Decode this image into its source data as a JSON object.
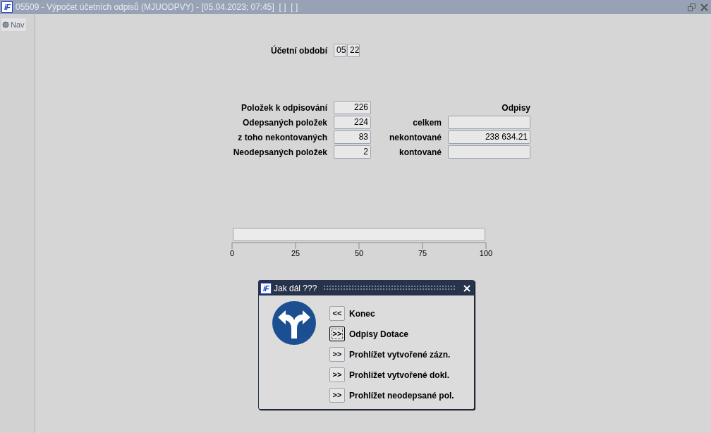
{
  "window": {
    "logo": "iF",
    "title": "05509 - Výpočet účetních odpisů (MJUODPVY) - [05.04.2023; 07:45]  [ ]  [ ]"
  },
  "sidebar": {
    "tabs": [
      {
        "label": "Nav",
        "selected": true
      }
    ]
  },
  "period": {
    "label": "Účetní období",
    "fields": [
      "05",
      "22"
    ]
  },
  "counts": [
    {
      "label": "Položek k odpisování",
      "value": "226"
    },
    {
      "label": "Odepsaných položek",
      "value": "224"
    },
    {
      "label": "z toho nekontovaných",
      "value": "83"
    },
    {
      "label": "Neodepsaných položek",
      "value": "2"
    }
  ],
  "odpisy": {
    "heading": "Odpisy",
    "rows": [
      {
        "label": "celkem",
        "value": ""
      },
      {
        "label": "nekontované",
        "value": "238 634.21"
      },
      {
        "label": "kontované",
        "value": ""
      }
    ]
  },
  "progress": {
    "level": 0,
    "scale": [
      "0",
      "25",
      "50",
      "75",
      "100"
    ]
  },
  "dialog": {
    "logo": "iF",
    "title": "Jak dál ???",
    "options": [
      {
        "button": "<<",
        "label": "Konec",
        "focused": false
      },
      {
        "button": ">>",
        "label": "Odpisy Dotace",
        "focused": true
      },
      {
        "button": ">>",
        "label": "Prohlížet vytvořené zázn.",
        "focused": false
      },
      {
        "button": ">>",
        "label": "Prohlížet vytvořené dokl.",
        "focused": false
      },
      {
        "button": ">>",
        "label": "Prohlížet neodepsané pol.",
        "focused": false
      }
    ]
  }
}
